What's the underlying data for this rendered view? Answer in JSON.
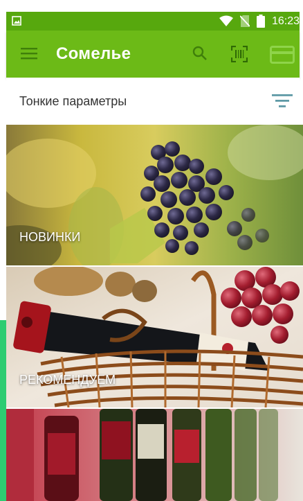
{
  "status_bar": {
    "time": "16:23",
    "icons": [
      "image-icon",
      "wifi-icon",
      "no-sim-icon",
      "battery-icon"
    ]
  },
  "app_bar": {
    "title": "Сомелье",
    "icons": [
      "menu-icon",
      "search-icon",
      "barcode-scan-icon",
      "card-icon"
    ]
  },
  "filter": {
    "label": "Тонкие параметры",
    "icon": "filter-icon"
  },
  "categories": [
    {
      "label": "НОВИНКИ"
    },
    {
      "label": "РЕКОМЕНДУЕМ"
    },
    {
      "label": ""
    }
  ],
  "colors": {
    "status_bar": "#57a80e",
    "app_bar": "#6cba17",
    "accent_edge": "#2ecc71"
  }
}
